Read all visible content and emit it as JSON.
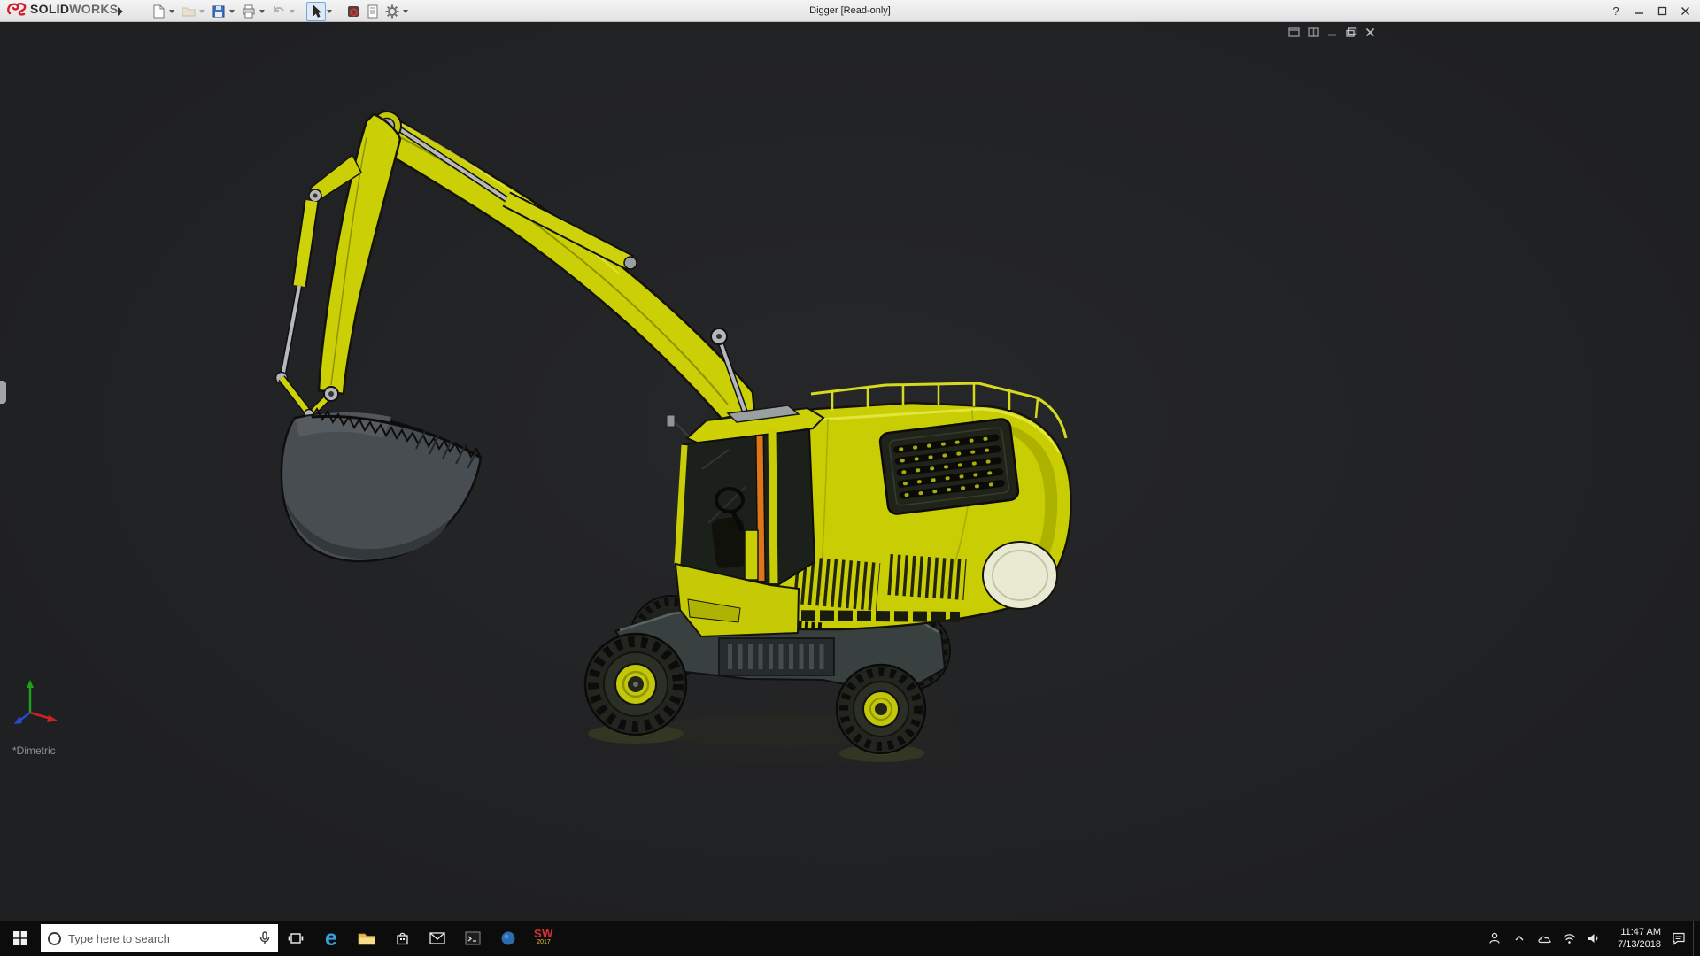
{
  "titlebar": {
    "brand_part1": "SOLID",
    "brand_part2": "WORKS",
    "document_title": "Digger [Read-only]",
    "help_glyph": "?",
    "toolbar_icon_names": [
      "new-document",
      "open-document",
      "save",
      "print",
      "undo",
      "select-arrow",
      "rebuild",
      "file-properties",
      "options-gear"
    ]
  },
  "viewport": {
    "view_orientation_label": "*Dimetric",
    "model_description": "yellow wheeled excavator 3D model with raised boom and bucket",
    "background_color": "#202124",
    "doc_window_icon_names": [
      "window-tile",
      "window-tile",
      "minimize-doc",
      "restore-doc",
      "close-doc"
    ]
  },
  "model_colors": {
    "body_yellow": "#c9cd04",
    "shade_yellow": "#a8ac00",
    "cab_accent_orange": "#df751b",
    "metal_gray": "#b3b7b7",
    "bucket_gray": "#474d50",
    "cream_panel": "#e9ead2"
  },
  "taskbar": {
    "search_placeholder": "Type here to search",
    "edge_glyph": "e",
    "app_icon_names": [
      "start",
      "cortana",
      "task-view",
      "edge",
      "file-explorer",
      "store",
      "mail",
      "console",
      "media-app",
      "solidworks-2017"
    ],
    "tray_icon_names": [
      "people",
      "chevron-up",
      "onedrive-cloud",
      "wifi",
      "volume",
      "action-center"
    ],
    "sw_badge": {
      "line1": "SW",
      "line2": "2017"
    },
    "clock_time": "11:47 AM",
    "clock_date": "7/13/2018"
  }
}
